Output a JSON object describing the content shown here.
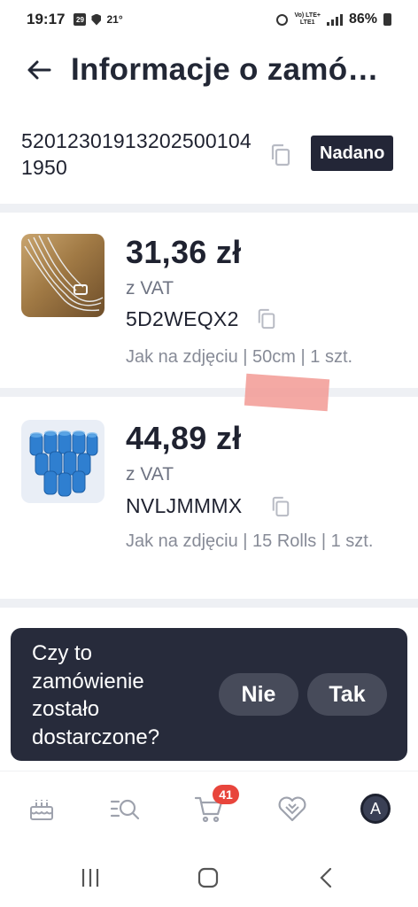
{
  "status_bar": {
    "time": "19:17",
    "date_icon_text": "29",
    "temperature": "21°",
    "network_top": "Vo) LTE+",
    "network_bottom": "LTE1",
    "battery": "86%"
  },
  "header": {
    "title": "Informacje o zamó…",
    "back_icon": "arrow-left-icon"
  },
  "order": {
    "number": "520123019132025001041950",
    "status": "Nadano",
    "copy_icon": "copy-icon"
  },
  "items": [
    {
      "price": "31,36 zł",
      "vat": "z VAT",
      "sku": "5D2WEQX2",
      "variant": "Jak na zdjęciu | 50cm | 1 szt.",
      "image": "silver-chain-necklace"
    },
    {
      "price": "44,89 zł",
      "vat": "z VAT",
      "sku": "NVLJMMMX",
      "variant": "Jak na zdjęciu | 15 Rolls | 1 szt.",
      "image": "blue-roll-bags"
    }
  ],
  "confirm": {
    "question": "Czy to zamówienie zostało dostarczone?",
    "no_label": "Nie",
    "yes_label": "Tak"
  },
  "tabbar": {
    "tabs": [
      "home-cake-icon",
      "search-list-icon",
      "cart-icon",
      "heart-icon",
      "avatar"
    ],
    "cart_count": "41",
    "avatar_letter": "A"
  },
  "colors": {
    "dark": "#232637",
    "badge_red": "#e8453c",
    "muted_text": "#878b97",
    "divider": "#eef0f4"
  }
}
